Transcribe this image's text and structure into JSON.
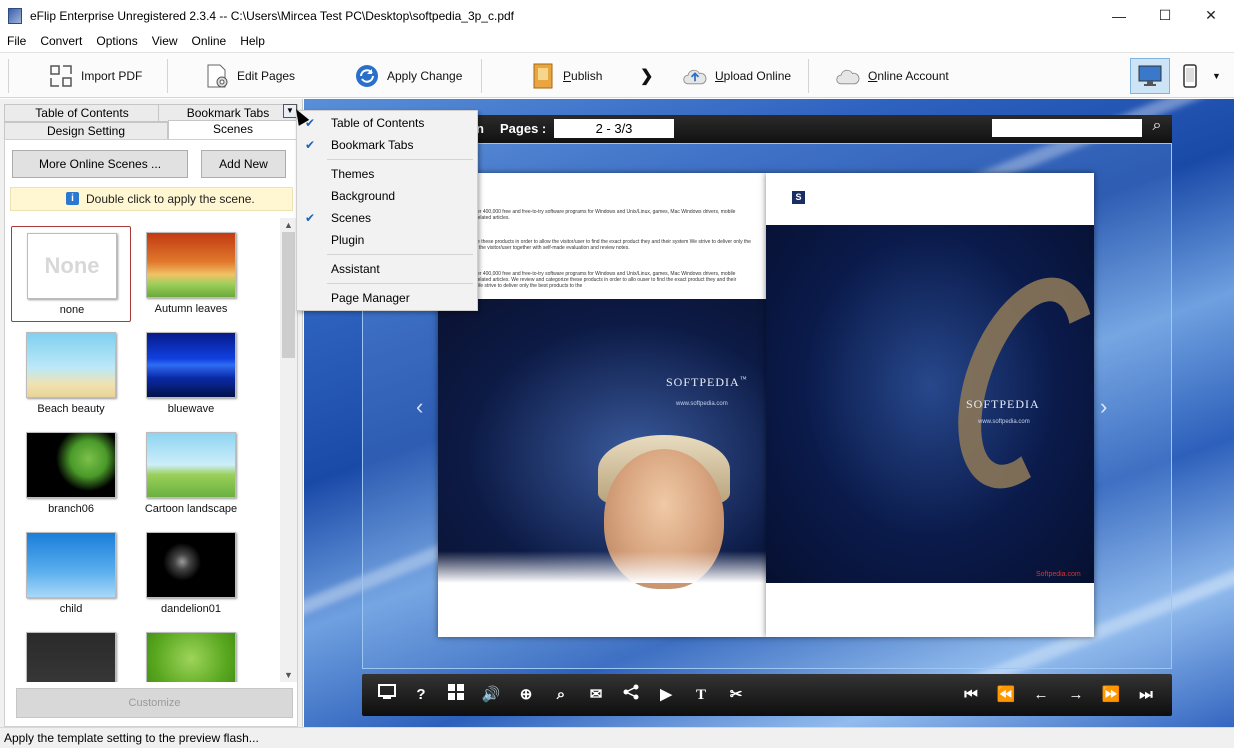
{
  "window": {
    "title": "eFlip Enterprise Unregistered 2.3.4  -- C:\\Users\\Mircea Test PC\\Desktop\\softpedia_3p_c.pdf",
    "minimize": "—",
    "maximize": "☐",
    "close": "✕"
  },
  "menu": [
    "File",
    "Convert",
    "Options",
    "View",
    "Online",
    "Help"
  ],
  "toolbar": {
    "import_pdf": "Import PDF",
    "edit_pages": "Edit Pages",
    "apply_change": "Apply Change",
    "publish": "Publish",
    "upload_online": "Upload Online",
    "online_account": "Online Account",
    "arrow": "❯",
    "more": "▼"
  },
  "tabs": {
    "table_of_contents": "Table of Contents",
    "bookmark_tabs": "Bookmark Tabs",
    "design_setting": "Design Setting",
    "scenes": "Scenes"
  },
  "panel": {
    "more_scenes": "More Online Scenes ...",
    "add_new": "Add New",
    "hint": "Double click to apply the scene.",
    "customize": "Customize"
  },
  "scenes": [
    {
      "label": "none",
      "thumb_text": "None"
    },
    {
      "label": "Autumn leaves"
    },
    {
      "label": "Beach beauty"
    },
    {
      "label": "bluewave"
    },
    {
      "label": "branch06"
    },
    {
      "label": "Cartoon landscape"
    },
    {
      "label": "child"
    },
    {
      "label": "dandelion01"
    },
    {
      "label": ""
    },
    {
      "label": ""
    }
  ],
  "dropdown": {
    "items": [
      {
        "label": "Table of Contents",
        "checked": true
      },
      {
        "label": "Bookmark Tabs",
        "checked": true
      },
      {
        "label": "Themes",
        "checked": false
      },
      {
        "label": "Background",
        "checked": false
      },
      {
        "label": "Scenes",
        "checked": true
      },
      {
        "label": "Plugin",
        "checked": false
      },
      {
        "label": "Assistant",
        "checked": false
      },
      {
        "label": "Page Manager",
        "checked": false
      }
    ],
    "check_glyph": "✔"
  },
  "viewer": {
    "pages_label": "Pages :",
    "pages_value": "2 - 3/3",
    "title_fragment": "n",
    "left_page_text": "is a library of over 400,000 free and free-to-try software programs for Windows and Unix/Linux, games, Mac Windows drivers, mobile devices and IT-related articles.",
    "left_page_text2": "w and categorize these products in order to allow the visitor/user to find the exact product they and their system We strive to deliver only the best products to the visitor/user together with self-made evaluation and review notes.",
    "left_page_text3": "is a library of over 400,000 free and free-to-try software programs for Windows and Unix/Linux, games, Mac Windows drivers, mobile devices and IT-related articles. We review and categorize these products in order to allo ouser to find the exact product they and their system needs. We strive to deliver only the best products to the",
    "logo": "SOFTPEDIA",
    "logo_tm": "™",
    "logo_url": "www.softpedia.com",
    "s_badge": "S",
    "corner_url": "Softpedia.com",
    "nav_prev": "‹",
    "nav_next": "›"
  },
  "status": {
    "text": "Apply the template setting to the preview flash..."
  },
  "colors": {
    "accent": "#1b63b8",
    "selection_border": "#a83a3a",
    "hint_bg": "#fff6d2"
  }
}
